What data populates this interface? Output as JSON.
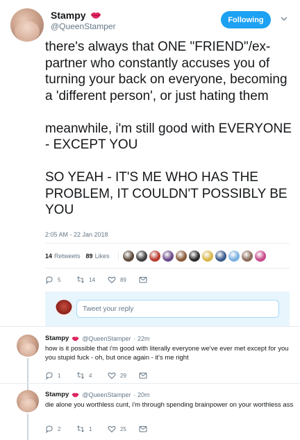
{
  "tweet": {
    "display_name": "Stampy",
    "handle": "@QueenStamper",
    "follow_label": "Following",
    "paragraphs": [
      "there's always that ONE \"FRIEND\"/ex-partner who constantly accuses you of turning your back on everyone, becoming a 'different person', or just hating them",
      "meanwhile, i'm still good with EVERYONE - EXCEPT YOU",
      "SO YEAH - IT'S ME WHO HAS THE PROBLEM, IT COULDN'T POSSIBLY BE YOU"
    ],
    "timestamp": "2:05 AM - 22 Jan 2018",
    "retweets_count": "14",
    "retweets_label": "Retweets",
    "likes_count": "89",
    "likes_label": "Likes",
    "liker_colors": [
      "#5a4a3a",
      "#3d3d3d",
      "#b83a2e",
      "#6b4a8a",
      "#8a5a3a",
      "#2a2a2a",
      "#d9b64a",
      "#3a5a8a",
      "#7ab0e0",
      "#8a6a5a",
      "#c84a8a"
    ],
    "actions": {
      "reply": "5",
      "retweet": "14",
      "like": "89"
    }
  },
  "reply_box": {
    "placeholder": "Tweet your reply"
  },
  "replies": [
    {
      "display_name": "Stampy",
      "handle": "@QueenStamper",
      "time": "· 22m",
      "text": "how is it possible that i'm good with literally everyone we've ever met except for you you stupid fuck - oh, but once again - it's me right",
      "actions": {
        "reply": "1",
        "retweet": "4",
        "like": "29"
      }
    },
    {
      "display_name": "Stampy",
      "handle": "@QueenStamper",
      "time": "· 20m",
      "text": "die alone you worthless cunt, i'm through spending brainpower on your worthless ass",
      "actions": {
        "reply": "2",
        "retweet": "1",
        "like": "25"
      }
    }
  ],
  "colors": {
    "accent": "#1da1f2",
    "muted": "#657786",
    "text": "#14171a",
    "lips": "#e0245e"
  }
}
